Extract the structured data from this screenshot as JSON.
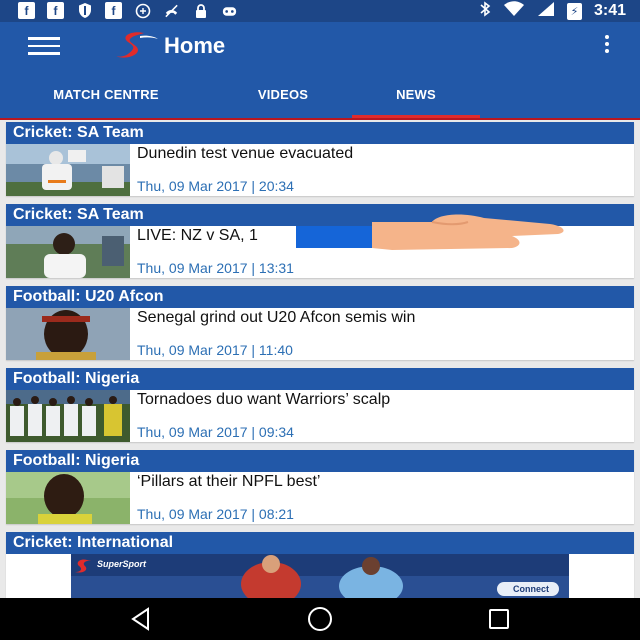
{
  "status_bar": {
    "left_icons": [
      "facebook-icon",
      "facebook-icon",
      "shield-icon",
      "facebook-icon",
      "data-saver-icon",
      "no-phone-icon",
      "lock-icon",
      "gamepad-icon"
    ],
    "right_icons": [
      "bluetooth-icon",
      "wifi-icon",
      "cellular-signal-icon",
      "battery-icon"
    ],
    "time": "3:41"
  },
  "app_bar": {
    "title": "Home",
    "accent": "#e02b2b",
    "background": "#2258a8"
  },
  "tabs": [
    {
      "label": "MATCH CENTRE",
      "selected": false
    },
    {
      "label": "VIDEOS",
      "selected": false
    },
    {
      "label": "NEWS",
      "selected": true
    }
  ],
  "news": [
    {
      "category": "Cricket: SA Team",
      "headline": "Dunedin test venue evacuated",
      "date": "Thu, 09 Mar 2017 | 20:34"
    },
    {
      "category": "Cricket: SA Team",
      "headline": "LIVE: NZ v SA, 1",
      "date": "Thu, 09 Mar 2017 | 13:31"
    },
    {
      "category": "Football: U20 Afcon",
      "headline": "Senegal grind out U20 Afcon semis win",
      "date": "Thu, 09 Mar 2017 | 11:40"
    },
    {
      "category": "Football: Nigeria",
      "headline": "Tornadoes duo want Warriors’ scalp",
      "date": "Thu, 09 Mar 2017 | 09:34"
    },
    {
      "category": "Football: Nigeria",
      "headline": "‘Pillars at their NPFL best’",
      "date": "Thu, 09 Mar 2017 | 08:21"
    },
    {
      "category": "Cricket: International",
      "headline": "",
      "date": ""
    }
  ],
  "banner": {
    "brand": "SuperSport",
    "cta": "Connect"
  },
  "nav_bar": {
    "buttons": [
      "back-icon",
      "home-icon",
      "recents-icon"
    ]
  }
}
